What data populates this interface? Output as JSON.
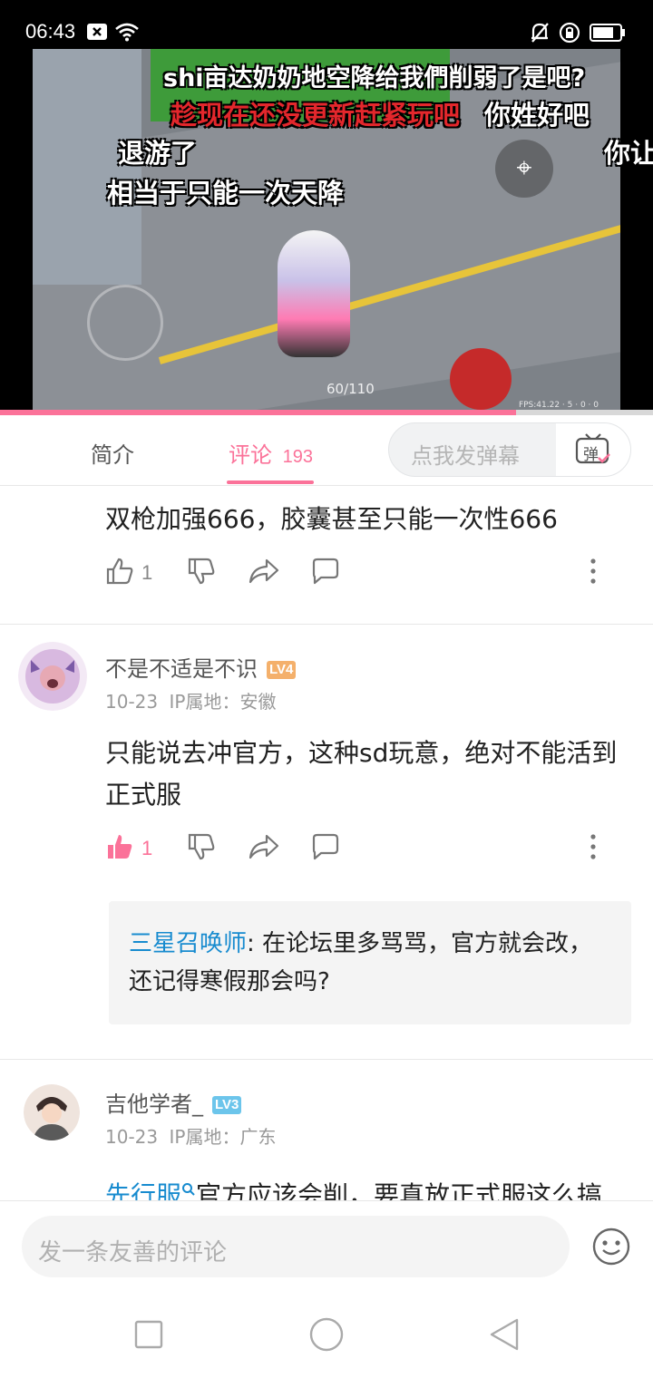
{
  "status_bar": {
    "time": "06:43"
  },
  "video": {
    "danmaku": [
      {
        "text": "shi亩达奶奶地空降给我們削弱了是吧?",
        "color": "white"
      },
      {
        "text": "趁现在还没更新赶紧玩吧",
        "color": "red"
      },
      {
        "text": "你姓好吧",
        "color": "white"
      },
      {
        "text": "退游了",
        "color": "white"
      },
      {
        "text": "你让",
        "color": "white"
      },
      {
        "text": "相当于只能一次天降",
        "color": "white"
      }
    ],
    "hud_ammo": "60/110",
    "hud_fps": "FPS:41.22 · 5 · 0 · 0",
    "progress": 0.79
  },
  "tabs": {
    "intro_label": "简介",
    "comments_label": "评论",
    "comments_count": "193",
    "danmaku_placeholder": "点我发弹幕",
    "danmaku_button_label": "弹"
  },
  "comments": [
    {
      "text": "双枪加强666，胶囊甚至只能一次性666",
      "likes": "1",
      "liked": false
    },
    {
      "username": "不是不适是不识",
      "level": "LV4",
      "date": "10-23",
      "location": "IP属地：安徽",
      "text": "只能说去冲官方，这种sd玩意，绝对不能活到正式服",
      "likes": "1",
      "liked": true,
      "reply": {
        "user": "三星召唤师",
        "text": ": 在论坛里多骂骂，官方就会改，还记得寒假那会吗?"
      }
    },
    {
      "username": "吉他学者_",
      "level": "LV3",
      "date": "10-23",
      "location": "IP属地：广东",
      "link_text": "先行服",
      "text": "官方应该会削，要真放正式服这么搞"
    }
  ],
  "input": {
    "placeholder": "发一条友善的评论"
  },
  "colors": {
    "accent": "#fb7299",
    "link": "#178bcf",
    "lv4": "#f4b06b",
    "lv3": "#6cc5eb"
  }
}
